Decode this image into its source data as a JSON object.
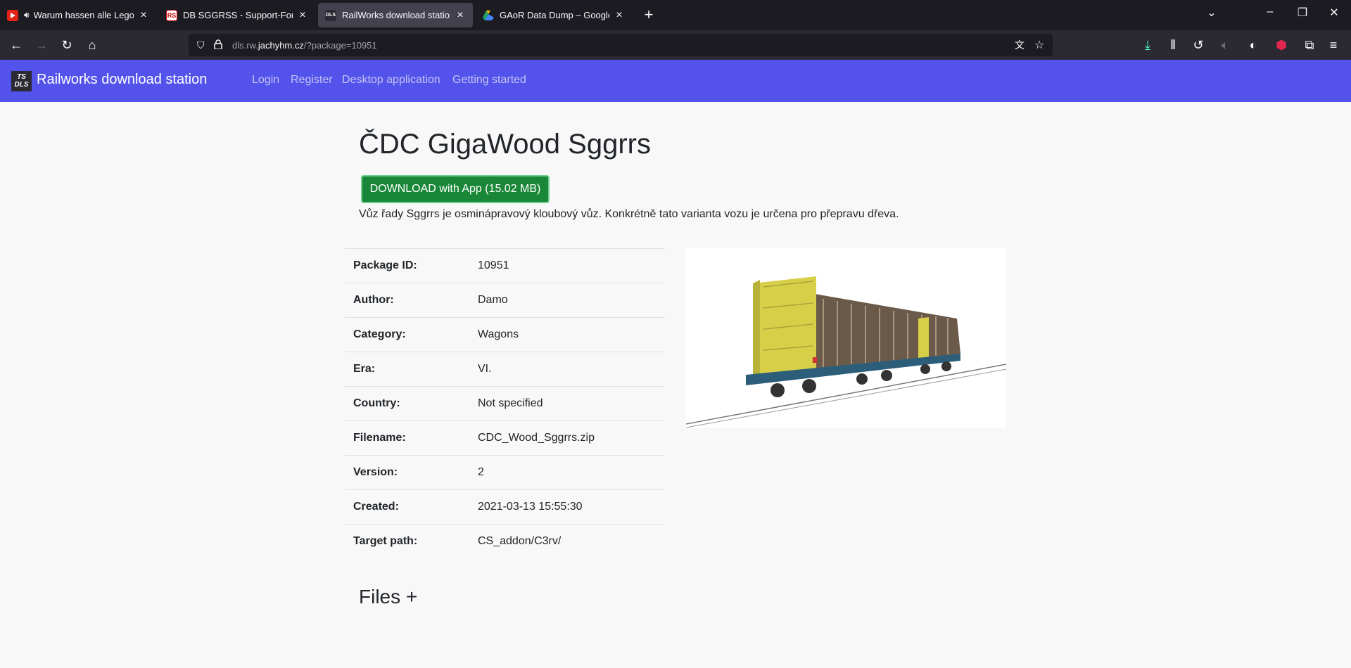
{
  "browser": {
    "tabs": [
      {
        "title": "Warum hassen alle Lego? -",
        "favicon": "youtube-icon",
        "active": false
      },
      {
        "title": "DB SGGRSS - Support-Forum -",
        "favicon": "rs-icon",
        "active": false
      },
      {
        "title": "RailWorks download station",
        "favicon": "tsdls-icon",
        "active": true
      },
      {
        "title": "GAoR Data Dump – Google Dri",
        "favicon": "google-drive-icon",
        "active": false
      }
    ],
    "url_prefix": "dls.rw.",
    "url_domain": "jachyhm.cz",
    "url_suffix": "/?package=10951"
  },
  "site": {
    "logo_text_1": "TS",
    "logo_text_2": "DLS",
    "brand": "Railworks download station",
    "nav": [
      "Login",
      "Register",
      "Desktop application",
      "Getting started"
    ]
  },
  "package": {
    "title": "ČDC GigaWood Sggrrs",
    "download_label": "DOWNLOAD with App (15.02 MB)",
    "description": "Vůz řady Sggrrs je osminápravový kloubový vůz. Konkrétně tato varianta vozu je určena pro přepravu dřeva.",
    "fields": [
      {
        "label": "Package ID:",
        "value": "10951"
      },
      {
        "label": "Author:",
        "value": "Damo"
      },
      {
        "label": "Category:",
        "value": "Wagons"
      },
      {
        "label": "Era:",
        "value": "VI."
      },
      {
        "label": "Country:",
        "value": "Not specified"
      },
      {
        "label": "Filename:",
        "value": "CDC_Wood_Sggrrs.zip"
      },
      {
        "label": "Version:",
        "value": "2"
      },
      {
        "label": "Created:",
        "value": "2021-03-13 15:55:30"
      },
      {
        "label": "Target path:",
        "value": "CS_addon/C3rv/"
      }
    ],
    "files_heading": "Files +"
  },
  "colors": {
    "site_nav": "#5353ec",
    "download_button": "#198737"
  }
}
